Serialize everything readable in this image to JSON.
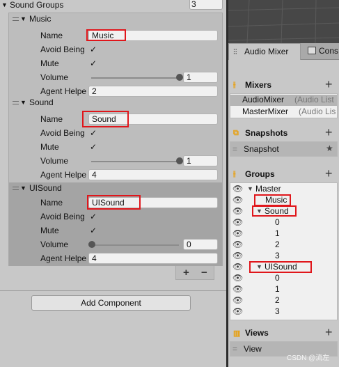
{
  "inspector": {
    "header_label": "Sound Groups",
    "count": "3",
    "add_component_label": "Add Component",
    "plus_label": "+",
    "minus_label": "−",
    "elements": [
      {
        "title": "Music",
        "name_label": "Name",
        "name_value": "Music",
        "avoid_label": "Avoid Being",
        "avoid_checked": "✓",
        "mute_label": "Mute",
        "mute_checked": "✓",
        "volume_label": "Volume",
        "volume_value": "1",
        "volume_fraction": 1,
        "agent_label": "Agent Helpe",
        "agent_value": "2"
      },
      {
        "title": "Sound",
        "name_label": "Name",
        "name_value": "Sound",
        "avoid_label": "Avoid Being",
        "avoid_checked": "✓",
        "mute_label": "Mute",
        "mute_checked": "✓",
        "volume_label": "Volume",
        "volume_value": "1",
        "volume_fraction": 1,
        "agent_label": "Agent Helpe",
        "agent_value": "4"
      },
      {
        "title": "UISound",
        "name_label": "Name",
        "name_value": "UISound",
        "avoid_label": "Avoid Being",
        "avoid_checked": "✓",
        "mute_label": "Mute",
        "mute_checked": "✓",
        "volume_label": "Volume",
        "volume_value": "0",
        "volume_fraction": 0,
        "agent_label": "Agent Helpe",
        "agent_value": "4"
      }
    ]
  },
  "mixer": {
    "tab_label": "Audio Mixer",
    "tab2_label": "Cons",
    "mixers_title": "Mixers",
    "mixers": [
      {
        "name": "AudioMixer",
        "detail": "(Audio List"
      },
      {
        "name": "MasterMixer",
        "detail": "(Audio Lis"
      }
    ],
    "snapshots_title": "Snapshots",
    "snapshot_item": "Snapshot",
    "groups_title": "Groups",
    "groups": [
      {
        "label": "Master",
        "tri": "▼"
      },
      {
        "label": "Music",
        "tri": ""
      },
      {
        "label": "Sound",
        "tri": "▼"
      },
      {
        "label": "0",
        "tri": ""
      },
      {
        "label": "1",
        "tri": ""
      },
      {
        "label": "2",
        "tri": ""
      },
      {
        "label": "3",
        "tri": ""
      },
      {
        "label": "UISound",
        "tri": "▼"
      },
      {
        "label": "0",
        "tri": ""
      },
      {
        "label": "1",
        "tri": ""
      },
      {
        "label": "2",
        "tri": ""
      },
      {
        "label": "3",
        "tri": ""
      }
    ],
    "views_title": "Views",
    "view_item": "View",
    "watermark": "CSDN @流左"
  },
  "colors": {
    "highlight": "#e0161b",
    "section_icon": "#e8a010"
  }
}
